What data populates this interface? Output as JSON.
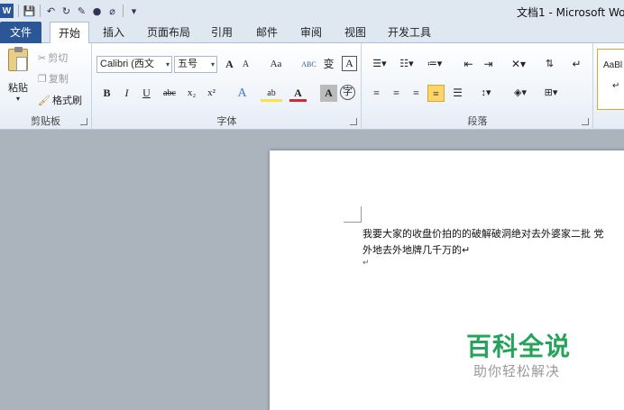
{
  "window": {
    "title": "文档1 - Microsoft Wo"
  },
  "qat": {
    "logo": "W",
    "save": "💾",
    "undo": "↶",
    "redo": "↻",
    "customize": "▾"
  },
  "tabs": [
    {
      "label": "文件"
    },
    {
      "label": "开始"
    },
    {
      "label": "插入"
    },
    {
      "label": "页面布局"
    },
    {
      "label": "引用"
    },
    {
      "label": "邮件"
    },
    {
      "label": "审阅"
    },
    {
      "label": "视图"
    },
    {
      "label": "开发工具"
    }
  ],
  "clipboard": {
    "group_label": "剪贴板",
    "paste": "粘贴",
    "cut": "剪切",
    "copy": "复制",
    "format_painter": "格式刷"
  },
  "font": {
    "group_label": "字体",
    "font_name": "Calibri (西文",
    "font_size": "五号",
    "grow": "A",
    "shrink": "A",
    "change_case": "Aa",
    "clear": "ABC",
    "phonetic": "变",
    "border": "A",
    "bold": "B",
    "italic": "I",
    "underline": "U",
    "strike": "abc",
    "subscript": "x₂",
    "superscript": "x²",
    "effects": "A",
    "highlight": "ab",
    "font_color": "A",
    "shading": "A",
    "enclose": "字"
  },
  "paragraph": {
    "group_label": "段落"
  },
  "styles": {
    "sample": "AaBl",
    "sample_line2": "↵"
  },
  "document": {
    "line1": "我要大家的收盘价拍的的破解破洞绝对去外婆家二批  党",
    "line2": "外地去外地牌几千万的↵",
    "line3": "↵"
  },
  "watermark": {
    "main": "百科全说",
    "sub": "助你轻松解决"
  },
  "colors": {
    "file_tab": "#2b5797",
    "accent_green": "#25a35a",
    "highlight": "#f7e14d",
    "font_red": "#d22c2c"
  }
}
